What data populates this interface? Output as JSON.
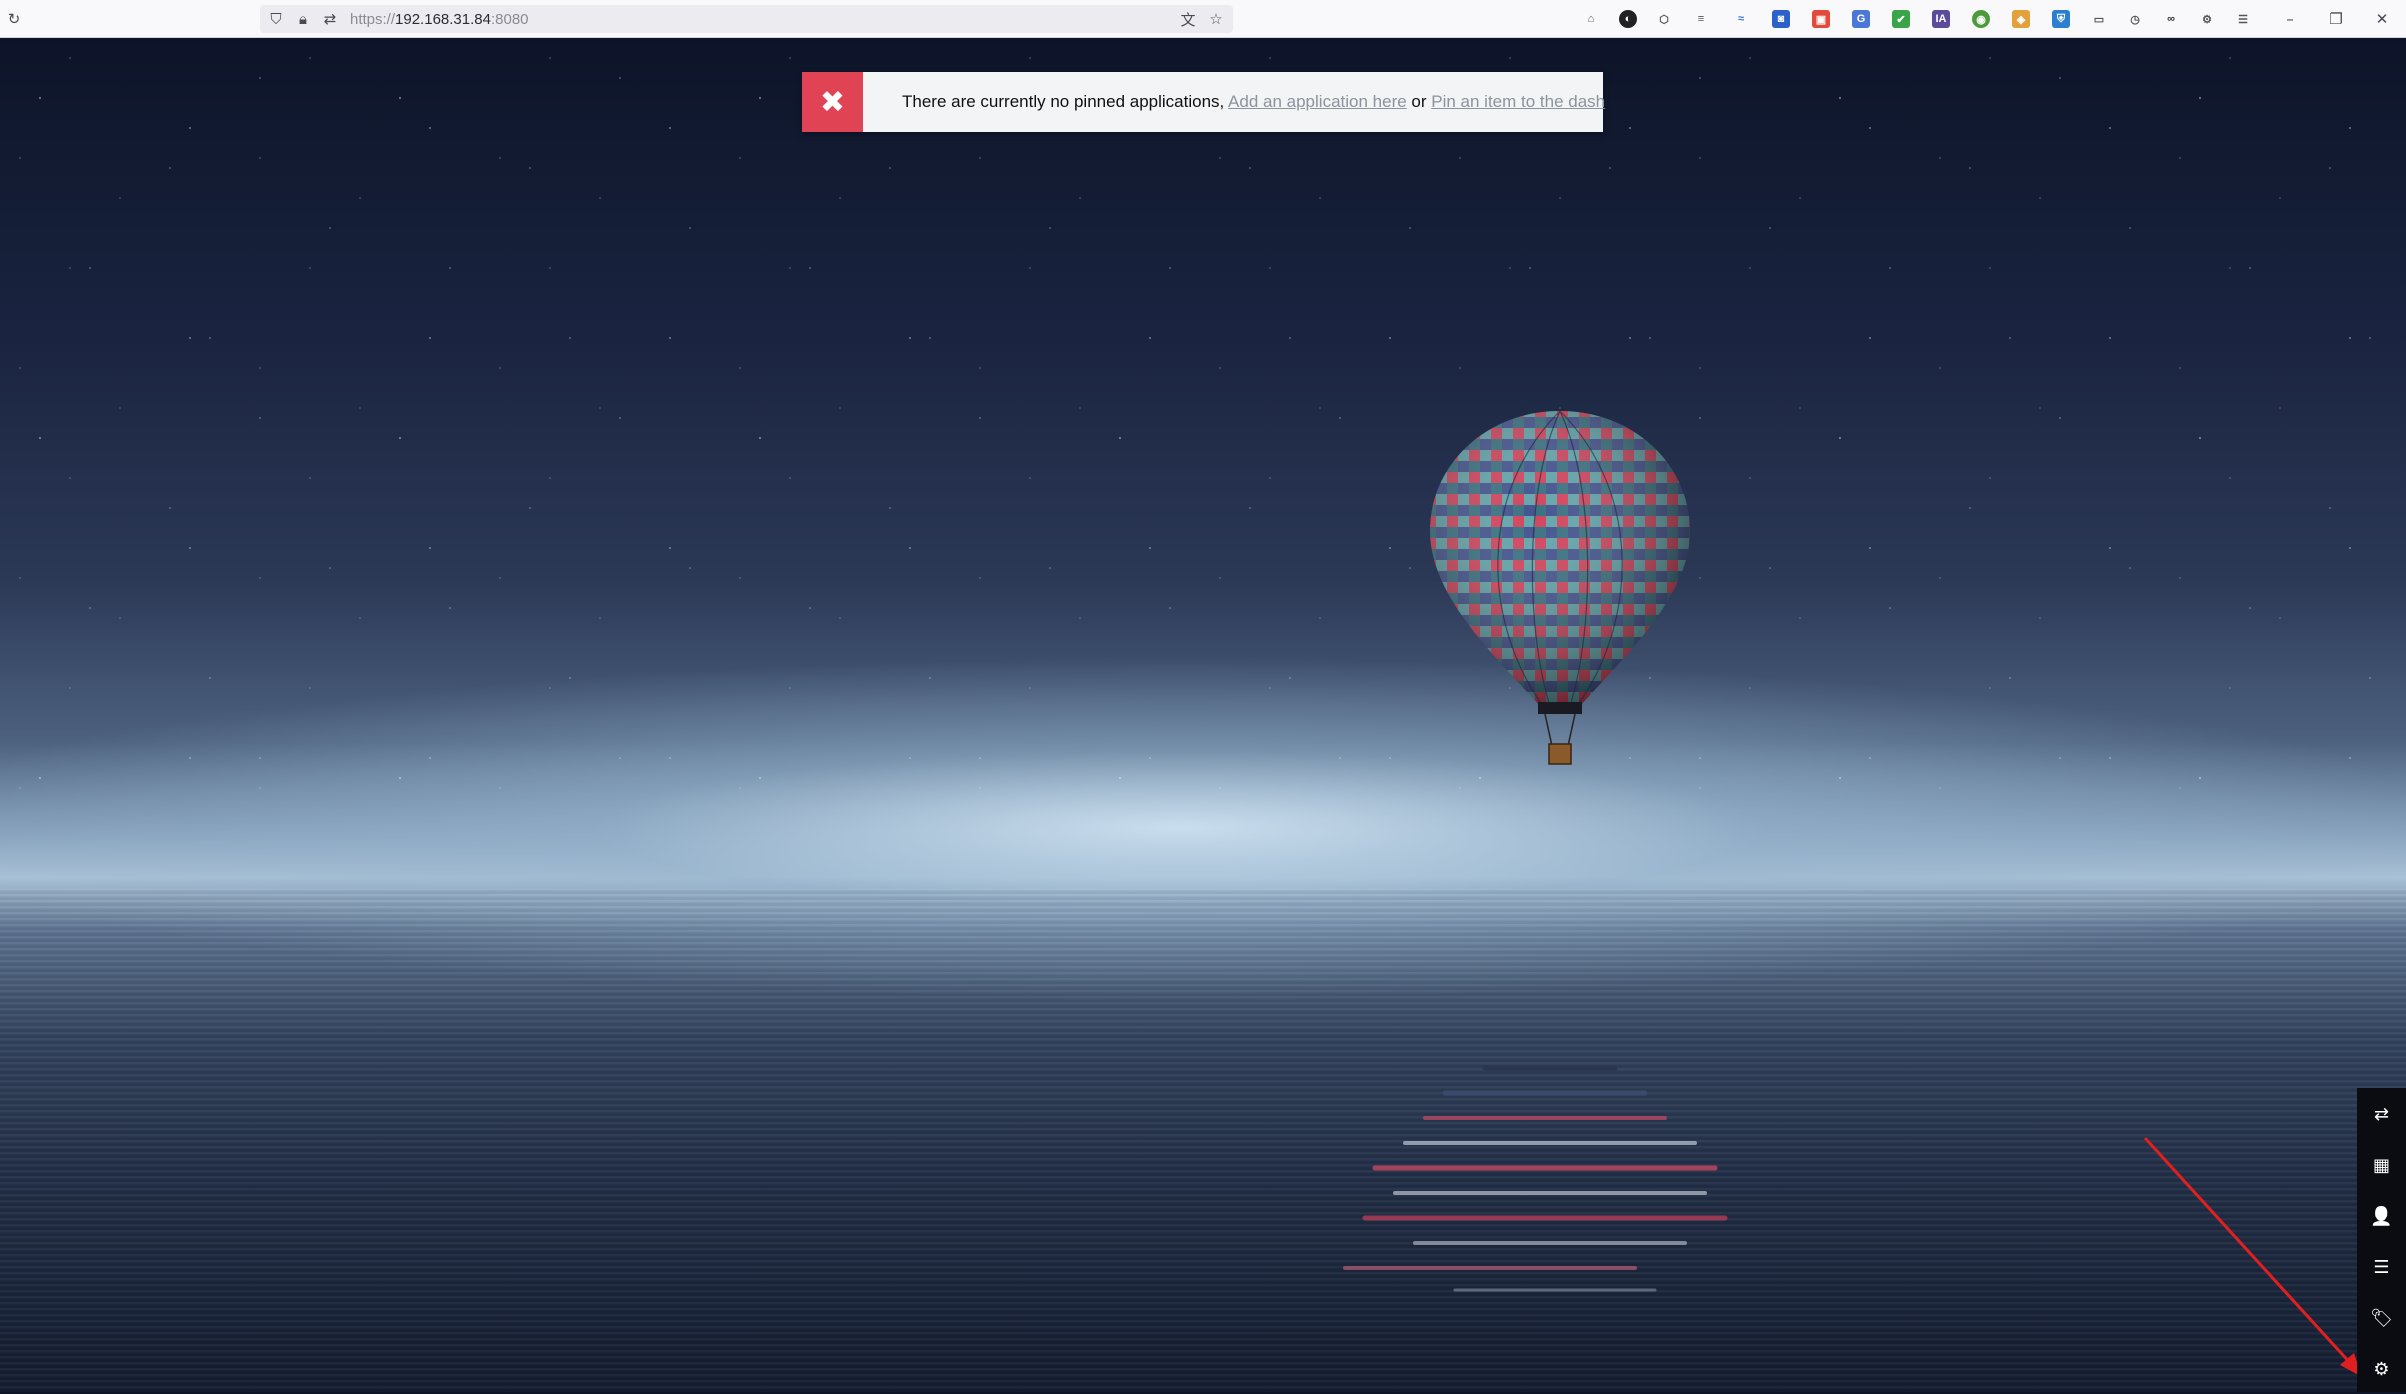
{
  "browser": {
    "url_scheme": "https://",
    "url_host": "192.168.31.84",
    "url_port": ":8080",
    "icons": {
      "reload": "reload-icon",
      "tracking_protection": "shield-icon",
      "site_info": "lock-icon",
      "permissions": "permissions-icon",
      "translate": "translate-icon",
      "bookmark": "star-icon"
    },
    "extensions": [
      "pocket-icon",
      "dark-reader-icon",
      "extension-icon",
      "reader-icon",
      "extension-blue-icon",
      "extension-blue2-icon",
      "extension-red-icon",
      "translate-ext-icon",
      "shield-green-icon",
      "ia-icon",
      "globe-icon",
      "extension-orange-icon",
      "bitwarden-icon",
      "container-icon",
      "history-icon",
      "glasses-icon",
      "settings-icon",
      "menu-icon"
    ],
    "window_controls": {
      "minimize": "–",
      "restore": "❐",
      "close": "✕"
    }
  },
  "notice": {
    "close_symbol": "✖",
    "message": "There are currently no pinned applications,",
    "link_add": "Add an application here",
    "connector": " or ",
    "link_pin": "Pin an item to the dash",
    "accent_color": "#e04454"
  },
  "sidemenu": [
    {
      "name": "switch-view-icon",
      "glyph": "⇄"
    },
    {
      "name": "apps-grid-icon",
      "glyph": "▦"
    },
    {
      "name": "user-icon",
      "glyph": "👤"
    },
    {
      "name": "list-icon",
      "glyph": "☰"
    },
    {
      "name": "tag-icon",
      "glyph": "🏷"
    },
    {
      "name": "settings-cogs-icon",
      "glyph": "⚙"
    }
  ]
}
